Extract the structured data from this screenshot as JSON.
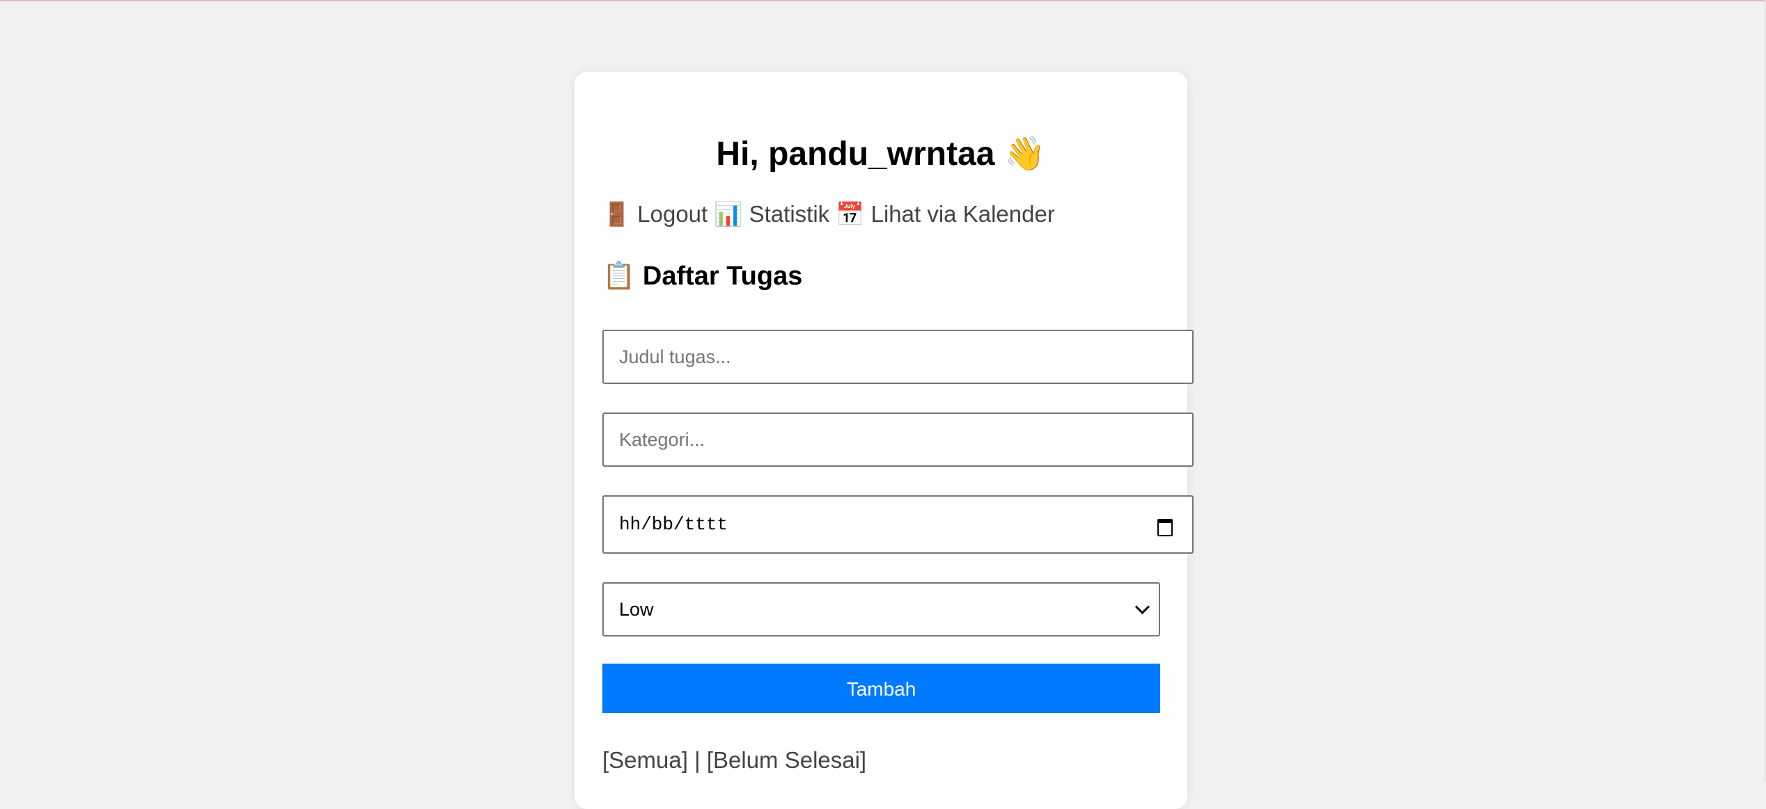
{
  "header": {
    "greeting": "Hi, pandu_wrntaa",
    "greeting_emoji": "👋"
  },
  "nav": {
    "logout_icon": "🚪",
    "logout_label": "Logout",
    "stats_icon": "📊",
    "stats_label": "Statistik",
    "calendar_icon": "📅",
    "calendar_label": "Lihat via Kalender"
  },
  "section": {
    "icon": "📋",
    "title": "Daftar Tugas"
  },
  "form": {
    "title_placeholder": "Judul tugas...",
    "category_placeholder": "Kategori...",
    "date_placeholder": "hh/bb/tttt",
    "priority_value": "Low",
    "submit_label": "Tambah"
  },
  "filters": {
    "all_label": "[Semua]",
    "separator": "|",
    "pending_label": "[Belum Selesai]"
  },
  "colors": {
    "accent": "#007bff",
    "background": "#f1f1f1",
    "card": "#ffffff"
  }
}
